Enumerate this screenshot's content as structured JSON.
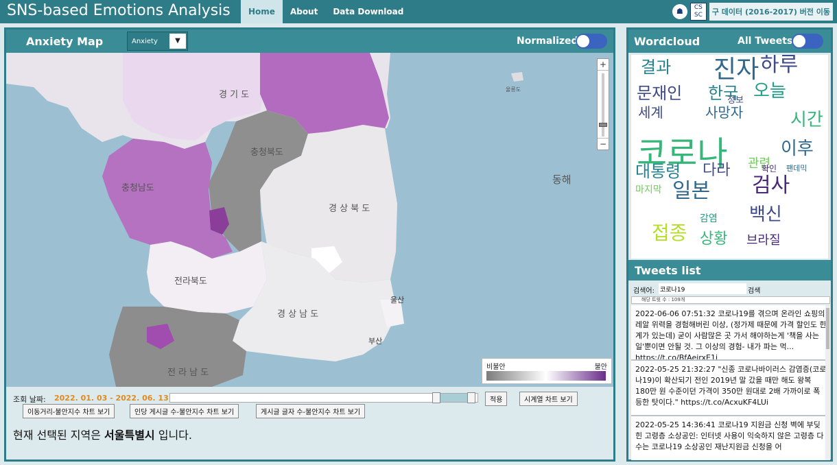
{
  "nav": {
    "app_title": "SNS-based Emotions Analysis",
    "items": [
      {
        "label": "Home",
        "active": true
      },
      {
        "label": "About",
        "active": false
      },
      {
        "label": "Data Download",
        "active": false
      }
    ],
    "logo_b_text": "CS SC",
    "legacy_button": "구 데이터 (2016-2017) 버전 이동"
  },
  "map_panel": {
    "title": "Anxiety Map",
    "select_value": "Anxiety",
    "select_arrow": "▼",
    "toggle_label": "Normalized",
    "toggle_on": true,
    "zoom_in": "+",
    "zoom_out": "−",
    "map_labels": {
      "east_sea": "동해",
      "ulleungdo": "울릉도",
      "gyeonggi": "경 기 도",
      "chungbuk": "충청북도",
      "chungnam": "충청남도",
      "gyeongbuk": "경 상 북 도",
      "jeonbuk": "전라북도",
      "gyeongnam": "경 상 남 도",
      "jeonnam": "전 라 남 도",
      "ulsan": "울산",
      "busan": "부산"
    },
    "legend": {
      "low": "비불안",
      "high": "불안",
      "low_color": "#7c7c7c",
      "mid_color": "#ffffff",
      "high_color": "#6a2d8a"
    },
    "date_label": "조회 날짜:",
    "date_value": "2022. 01. 03 - 2022. 06. 13",
    "apply_button": "적용",
    "timeseries_button": "시계열 차트 보기",
    "chart_buttons": [
      "이동거리-불안지수 차트 보기",
      "인당 게시글 수-불안지수 차트 보기",
      "게시글 글자 수-불안지수 차트 보기"
    ],
    "status_prefix": "현재 선택된 지역은",
    "status_region": "서울특별시",
    "status_suffix": "입니다."
  },
  "right_panel": {
    "wordcloud_title": "Wordcloud",
    "all_tweets_label": "All Tweets",
    "all_tweets_on": true,
    "tweets_title": "Tweets list",
    "search_label": "검색어:",
    "search_value": "코로나19",
    "search_button": "검색",
    "count_text": "해당 트윗 수 : 109개",
    "tweets": [
      {
        "text": "2022-06-06 07:51:32 코로나19를 겪으며 온라인 쇼핑의 레알 위력을 경험해버린 이상, (정가제 때문에 가격 할인도 한계가 있는데) 굳이 사람많은 곳 가서 해야하는게 '책을 사는 일'뿐이면 안될 것. 그 이상의 경험- 내가 파는 먹... https://t.co/BfAeirxE1j"
      },
      {
        "text": "2022-05-25 21:32:27 \"신종 코로나바이러스 감염증(코로나19)이 확산되기 전인 2019년 말 갔을 때만 해도 왕복 180만 원 수준이던 가격이 350만 원대로 2배 가까이로 폭등한 탓이다.\" https://t.co/AcxuKF4LUi"
      },
      {
        "text": "2022-05-25 14:36:41 코로나19 지원금 신청 벽에 부딪힌 고령층 소상공인: 인터넷 사용이 익숙하지 않은 고령층 다수는 코로나19 소상공인 재난지원금 신청을 어"
      }
    ]
  },
  "wordcloud": {
    "words": [
      {
        "t": "코로나",
        "c": "#35b779"
      },
      {
        "t": "진자",
        "c": "#31688e"
      },
      {
        "t": "하루",
        "c": "#3e4a89"
      },
      {
        "t": "결과",
        "c": "#26828e"
      },
      {
        "t": "문재인",
        "c": "#3e4a89"
      },
      {
        "t": "한국",
        "c": "#26828e"
      },
      {
        "t": "오늘",
        "c": "#1f9e89"
      },
      {
        "t": "세계",
        "c": "#3e4a89"
      },
      {
        "t": "사망자",
        "c": "#31688e"
      },
      {
        "t": "시간",
        "c": "#35b779"
      },
      {
        "t": "이후",
        "c": "#31688e"
      },
      {
        "t": "대통령",
        "c": "#26828e"
      },
      {
        "t": "다라",
        "c": "#3e4a89"
      },
      {
        "t": "관련",
        "c": "#6ece58"
      },
      {
        "t": "일본",
        "c": "#31688e"
      },
      {
        "t": "검사",
        "c": "#482878"
      },
      {
        "t": "백신",
        "c": "#3e4a89"
      },
      {
        "t": "접종",
        "c": "#b5de2b"
      },
      {
        "t": "상황",
        "c": "#35b779"
      },
      {
        "t": "브라질",
        "c": "#482878"
      },
      {
        "t": "팬데믹",
        "c": "#31688e"
      },
      {
        "t": "감염",
        "c": "#1f9e89"
      },
      {
        "t": "확인",
        "c": "#482878"
      },
      {
        "t": "정보",
        "c": "#3e4a89"
      },
      {
        "t": "마지막",
        "c": "#6ece58"
      }
    ]
  }
}
